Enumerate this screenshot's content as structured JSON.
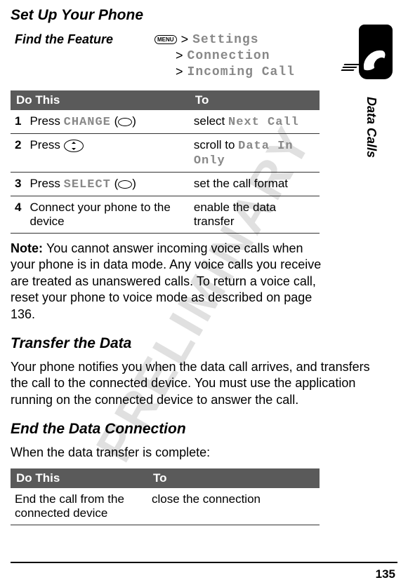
{
  "watermark": "PRELIMINARY",
  "heading_setup": "Set Up Your Phone",
  "find_feature": {
    "label": "Find the Feature",
    "menu_icon": "MENU",
    "path1_gt": ">",
    "path1": "Settings",
    "path2_gt": ">",
    "path2": "Connection",
    "path3_gt": ">",
    "path3": "Incoming Call"
  },
  "table1": {
    "header_do": "Do This",
    "header_to": "To",
    "rows": [
      {
        "num": "1",
        "do_prefix": "Press ",
        "do_menu": "CHANGE",
        "do_suffix": " (",
        "do_close": ")",
        "to_prefix": "select ",
        "to_menu": "Next Call"
      },
      {
        "num": "2",
        "do_prefix": "Press ",
        "to_prefix": "scroll to ",
        "to_menu": "Data In Only"
      },
      {
        "num": "3",
        "do_prefix": "Press ",
        "do_menu": "SELECT",
        "do_suffix": " (",
        "do_close": ")",
        "to": "set the call format"
      },
      {
        "num": "4",
        "do": "Connect your phone to the device",
        "to": "enable the data transfer"
      }
    ]
  },
  "note": {
    "label": "Note: ",
    "text": "You cannot answer incoming voice calls when your phone is in data mode. Any voice calls you receive are treated as unanswered calls. To return a voice call, reset your phone to voice mode as described on page 136."
  },
  "heading_transfer": "Transfer the Data",
  "transfer_text": "Your phone notifies you when the data call arrives, and transfers the call to the connected device. You must use the application running on the connected device to answer the call.",
  "heading_end": "End the Data Connection",
  "end_text": "When the data transfer is complete:",
  "table2": {
    "header_do": "Do This",
    "header_to": "To",
    "row": {
      "do": "End the call from the connected device",
      "to": "close the connection"
    }
  },
  "side_label": "Data Calls",
  "page_number": "135"
}
